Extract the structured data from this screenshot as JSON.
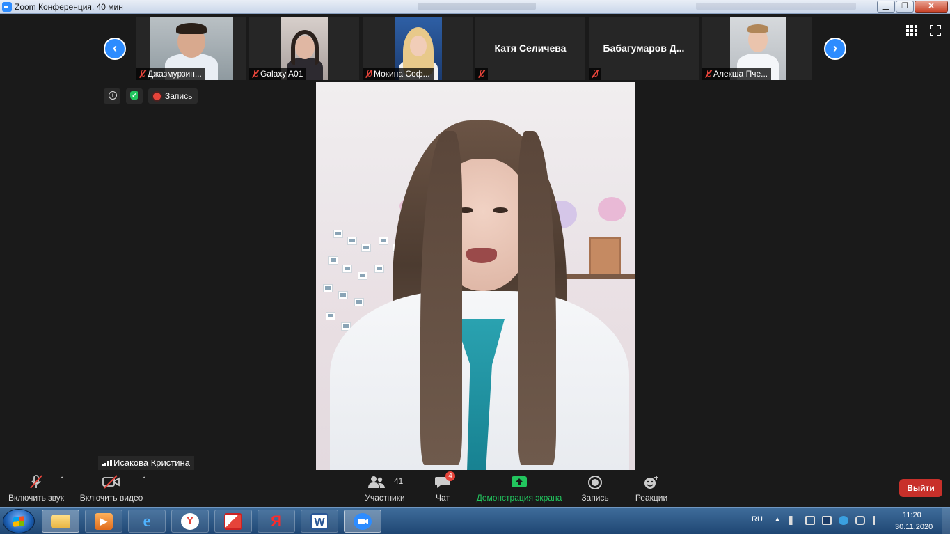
{
  "window": {
    "title": "Zoom Конференция, 40 мин"
  },
  "filmstrip": {
    "tiles": [
      {
        "name": "Джазмурзин..."
      },
      {
        "name": "Galaxy A01"
      },
      {
        "name": "Мокина Соф..."
      },
      {
        "name": "Катя Селичева"
      },
      {
        "name": "Бабагумаров Д..."
      },
      {
        "name": "Алекша Пче..."
      }
    ]
  },
  "meeting_info": {
    "recording_label": "Запись"
  },
  "active_speaker": {
    "name": "Исакова Кристина"
  },
  "toolbar": {
    "audio_label": "Включить звук",
    "video_label": "Включить видео",
    "participants_label": "Участники",
    "participants_count": "41",
    "chat_label": "Чат",
    "chat_badge": "4",
    "share_label": "Демонстрация экрана",
    "record_label": "Запись",
    "reactions_label": "Реакции",
    "leave_label": "Выйти"
  },
  "taskbar": {
    "language": "RU",
    "time": "11:20",
    "date": "30.11.2020",
    "yandex_glyph": "Я",
    "word_glyph": "W"
  },
  "colors": {
    "accent": "#2d8cff",
    "share_green": "#22c55e",
    "muted_red": "#e6443a",
    "leave_red": "#c8302a"
  }
}
